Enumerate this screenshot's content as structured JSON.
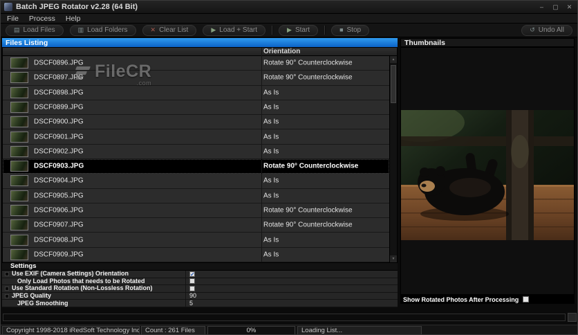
{
  "window": {
    "title": "Batch JPEG Rotator v2.28 (64 Bit)"
  },
  "icons": {
    "minimize": "–",
    "maximize": "▢",
    "close": "✕",
    "load_files": "▤",
    "load_folders": "▥",
    "clear_list": "✕",
    "load_start": "▶",
    "start": "▶",
    "stop": "■",
    "undo": "↺",
    "scroll_up": "▲",
    "scroll_down": "▼",
    "check": "✓"
  },
  "menu": {
    "items": [
      "File",
      "Process",
      "Help"
    ]
  },
  "toolbar": {
    "buttons": [
      {
        "label": "Load Files"
      },
      {
        "label": "Load Folders"
      },
      {
        "label": "Clear List"
      },
      {
        "label": "Load + Start"
      },
      {
        "label": "Start"
      },
      {
        "label": "Stop"
      },
      {
        "label": "Undo All"
      }
    ]
  },
  "files": {
    "header": "Files Listing",
    "orientation_column": "Orientation",
    "rows": [
      {
        "name": "DSCF0896.JPG",
        "orientation": "Rotate 90° Counterclockwise",
        "selected": false
      },
      {
        "name": "DSCF0897.JPG",
        "orientation": "Rotate 90° Counterclockwise",
        "selected": false
      },
      {
        "name": "DSCF0898.JPG",
        "orientation": "As Is",
        "selected": false
      },
      {
        "name": "DSCF0899.JPG",
        "orientation": "As Is",
        "selected": false
      },
      {
        "name": "DSCF0900.JPG",
        "orientation": "As Is",
        "selected": false
      },
      {
        "name": "DSCF0901.JPG",
        "orientation": "As Is",
        "selected": false
      },
      {
        "name": "DSCF0902.JPG",
        "orientation": "As Is",
        "selected": false
      },
      {
        "name": "DSCF0903.JPG",
        "orientation": "Rotate 90° Counterclockwise",
        "selected": true
      },
      {
        "name": "DSCF0904.JPG",
        "orientation": "As Is",
        "selected": false
      },
      {
        "name": "DSCF0905.JPG",
        "orientation": "As Is",
        "selected": false
      },
      {
        "name": "DSCF0906.JPG",
        "orientation": "Rotate 90° Counterclockwise",
        "selected": false
      },
      {
        "name": "DSCF0907.JPG",
        "orientation": "Rotate 90° Counterclockwise",
        "selected": false
      },
      {
        "name": "DSCF0908.JPG",
        "orientation": "As Is",
        "selected": false
      },
      {
        "name": "DSCF0909.JPG",
        "orientation": "As Is",
        "selected": false
      }
    ]
  },
  "watermark": {
    "brand": "FileCR",
    "tld": ".com"
  },
  "settings": {
    "header": "Settings",
    "rows": [
      {
        "label": "Use EXIF (Camera Settings) Orientation",
        "control": "checkbox",
        "checked": true,
        "bullet": true,
        "indent": false
      },
      {
        "label": "Only Load Photos that needs to be Rotated",
        "control": "checkbox",
        "checked": false,
        "bullet": false,
        "indent": true
      },
      {
        "label": "Use Standard Rotation (Non-Lossless Rotation)",
        "control": "checkbox",
        "checked": false,
        "bullet": true,
        "indent": false
      },
      {
        "label": "JPEG Quality",
        "control": "value",
        "value": "90",
        "bullet": true,
        "indent": false
      },
      {
        "label": "JPEG Smoothing",
        "control": "value",
        "value": "5",
        "bullet": false,
        "indent": true
      }
    ]
  },
  "thumbnails": {
    "header": "Thumbnails",
    "show_rotated_label": "Show Rotated Photos After Processing",
    "show_rotated_checked": false
  },
  "statusbar": {
    "copyright": "Copyright 1998-2018 iRedSoft Technology Inc",
    "count": "Count : 261 Files",
    "progress_percent": "0%",
    "status": "Loading List..."
  },
  "colors": {
    "header_blue": "#1a7fd9",
    "selection_black": "#000000",
    "row_gray": "#2c2c2c"
  }
}
